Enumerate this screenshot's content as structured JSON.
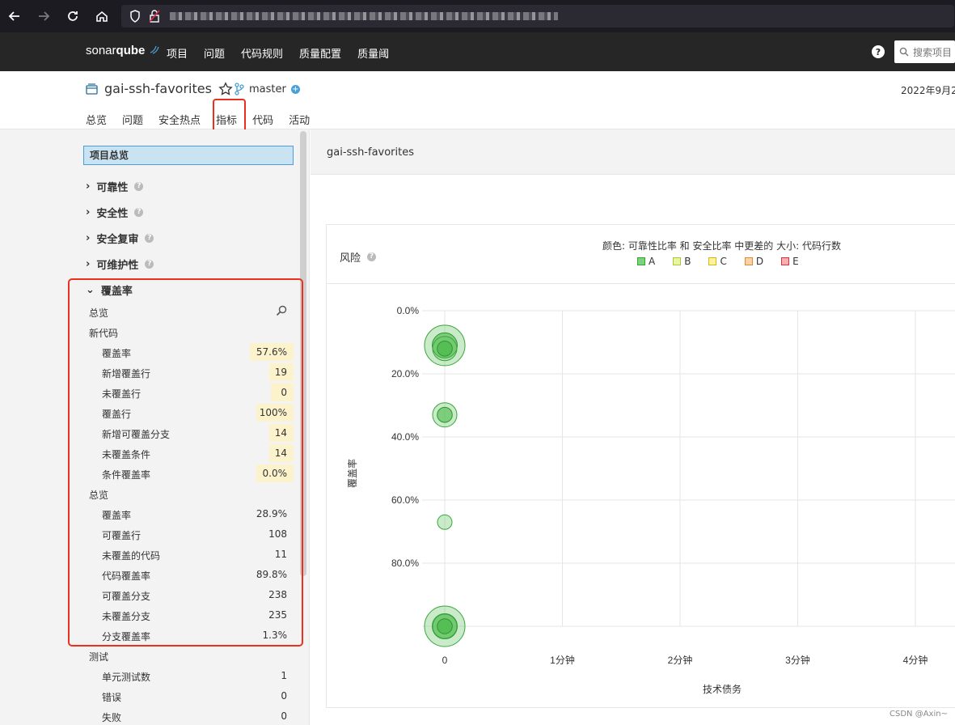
{
  "browser": {
    "url": ""
  },
  "nav": {
    "logo_main": "sonar",
    "logo_bold": "qube",
    "items": [
      "项目",
      "问题",
      "代码规则",
      "质量配置",
      "质量阈"
    ],
    "search_placeholder": "搜索项目"
  },
  "project": {
    "name": "gai-ssh-favorites",
    "branch": "master",
    "date": "2022年9月2",
    "tabs": [
      "总览",
      "问题",
      "安全热点",
      "指标",
      "代码",
      "活动"
    ],
    "active_tab": "指标"
  },
  "sidebar": {
    "overview": "项目总览",
    "domains": [
      "可靠性",
      "安全性",
      "安全复审",
      "可维护性"
    ],
    "coverage": {
      "title": "覆盖率",
      "overview_label": "总览",
      "new_code_label": "新代码",
      "new_code": [
        {
          "label": "覆盖率",
          "value": "57.6%"
        },
        {
          "label": "新增覆盖行",
          "value": "19"
        },
        {
          "label": "未覆盖行",
          "value": "0"
        },
        {
          "label": "覆盖行",
          "value": "100%"
        },
        {
          "label": "新增可覆盖分支",
          "value": "14"
        },
        {
          "label": "未覆盖条件",
          "value": "14"
        },
        {
          "label": "条件覆盖率",
          "value": "0.0%"
        }
      ],
      "overall_label": "总览",
      "overall": [
        {
          "label": "覆盖率",
          "value": "28.9%"
        },
        {
          "label": "可覆盖行",
          "value": "108"
        },
        {
          "label": "未覆盖的代码",
          "value": "11"
        },
        {
          "label": "代码覆盖率",
          "value": "89.8%"
        },
        {
          "label": "可覆盖分支",
          "value": "238"
        },
        {
          "label": "未覆盖分支",
          "value": "235"
        },
        {
          "label": "分支覆盖率",
          "value": "1.3%"
        }
      ]
    },
    "tests": {
      "title": "测试",
      "rows": [
        {
          "label": "单元测试数",
          "value": "1"
        },
        {
          "label": "错误",
          "value": "0"
        },
        {
          "label": "失败",
          "value": "0"
        }
      ]
    }
  },
  "main": {
    "title": "gai-ssh-favorites",
    "risk_label": "风险",
    "legend_title": "颜色: 可靠性比率 和 安全比率 中更差的  大小: 代码行数",
    "legend": [
      {
        "label": "A",
        "color": "#b0d513"
      },
      {
        "label": "B",
        "color": "#eabe06"
      },
      {
        "label": "C",
        "color": "#ed7d20"
      },
      {
        "label": "D",
        "color": "#e57d20"
      },
      {
        "label": "E",
        "color": "#d4333f"
      }
    ]
  },
  "chart_data": {
    "type": "scatter",
    "xlabel": "技术债务",
    "ylabel": "覆盖率",
    "x_ticks": [
      "0",
      "1分钟",
      "2分钟",
      "3分钟",
      "4分钟"
    ],
    "y_ticks": [
      "0.0%",
      "20.0%",
      "40.0%",
      "60.0%",
      "80.0%"
    ],
    "ylim": [
      0,
      100
    ],
    "xlim": [
      0,
      4
    ],
    "points": [
      {
        "x": 0,
        "y": 11,
        "size": "large",
        "rating": "A"
      },
      {
        "x": 0,
        "y": 12,
        "size": "medium",
        "rating": "A"
      },
      {
        "x": 0,
        "y": 33,
        "size": "medium",
        "rating": "A"
      },
      {
        "x": 0,
        "y": 67,
        "size": "small",
        "rating": "A"
      },
      {
        "x": 0,
        "y": 100,
        "size": "large",
        "rating": "A"
      },
      {
        "x": 0,
        "y": 100,
        "size": "medium",
        "rating": "A"
      }
    ]
  },
  "watermark": "CSDN @Axin~"
}
